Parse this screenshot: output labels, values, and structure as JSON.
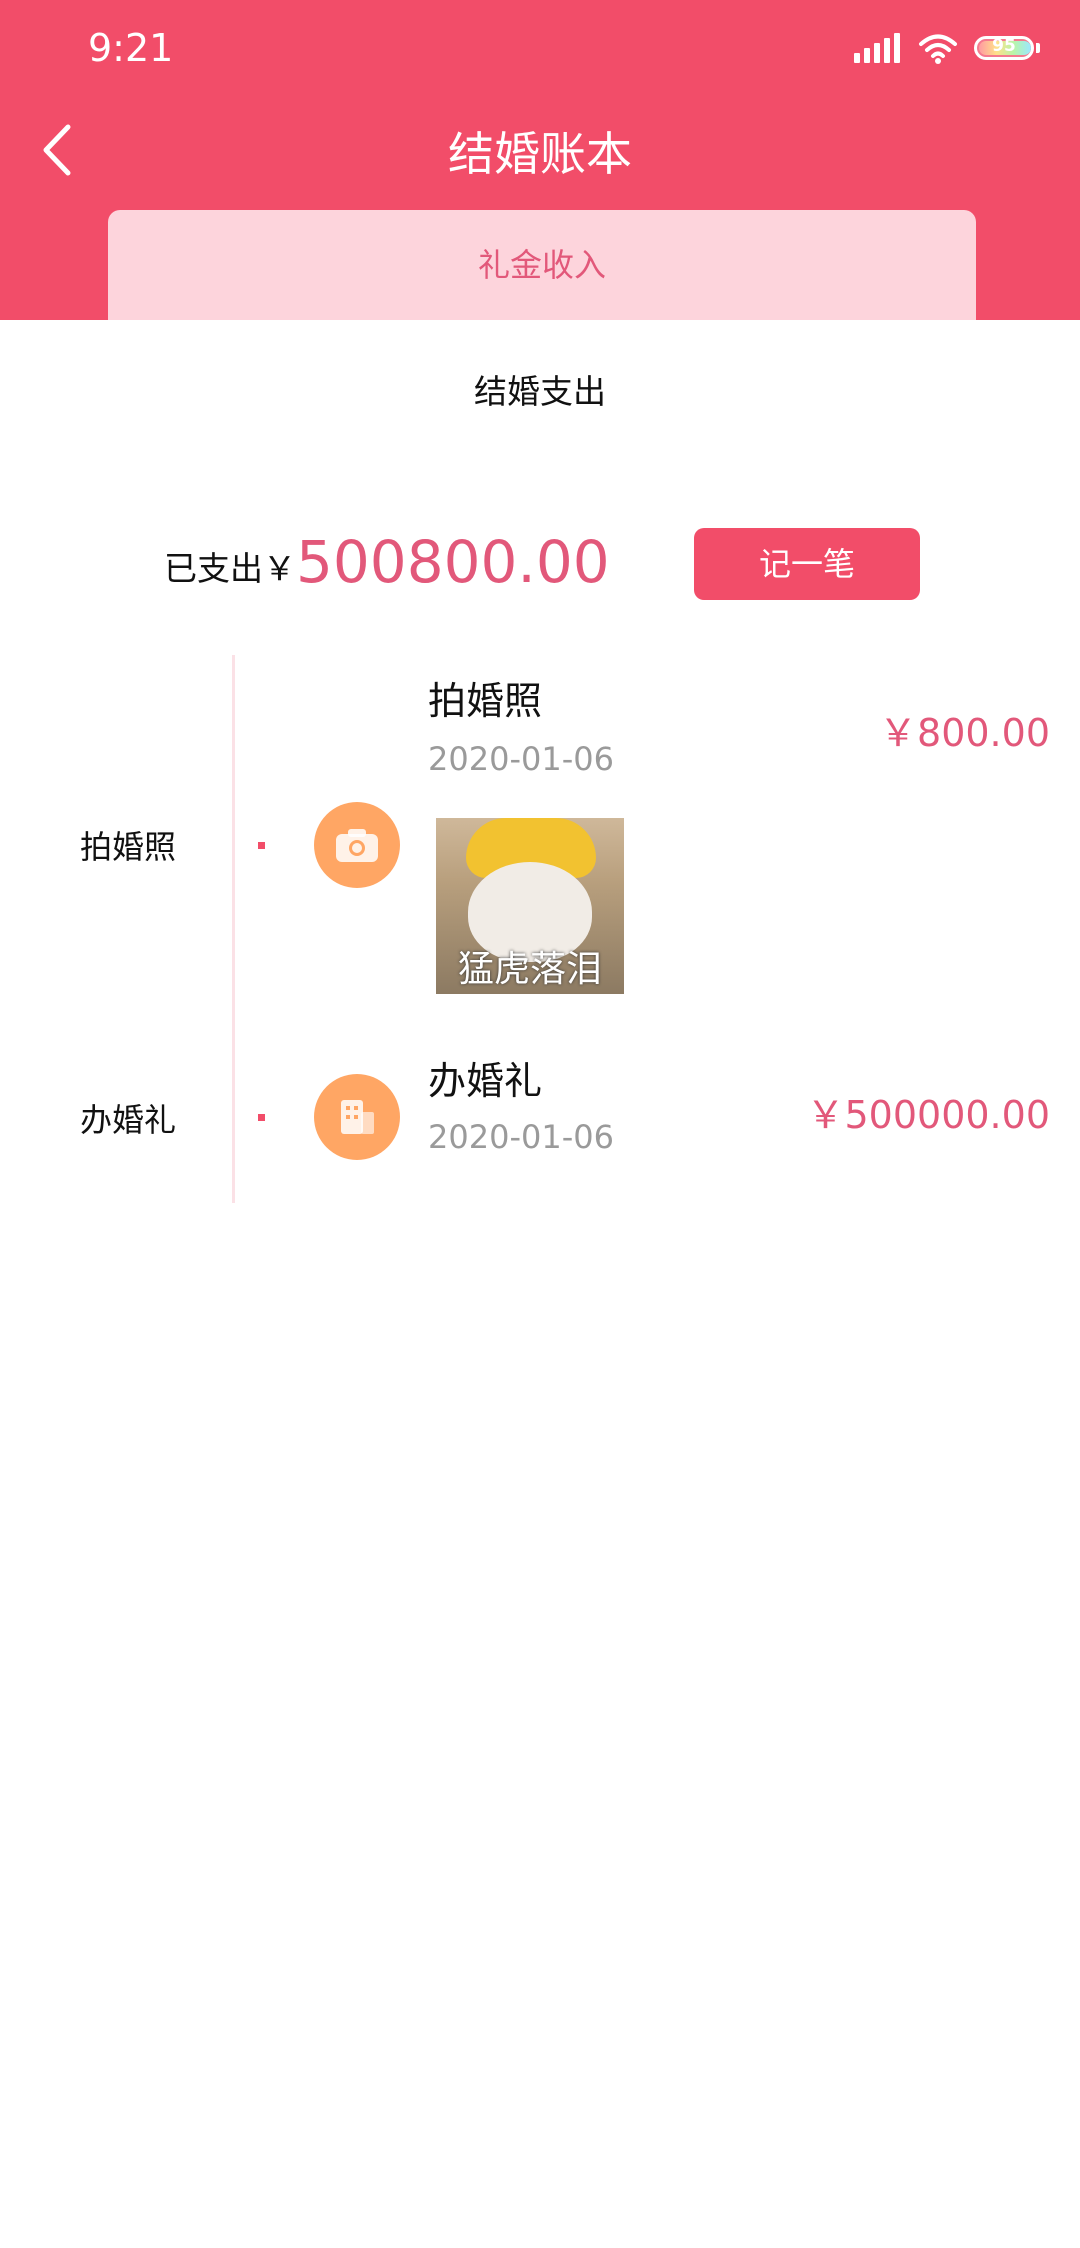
{
  "status_bar": {
    "time": "9:21",
    "battery": "95"
  },
  "header": {
    "title": "结婚账本"
  },
  "tabs": {
    "income": "礼金收入",
    "expense": "结婚支出"
  },
  "summary": {
    "label": "已支出￥",
    "amount": "500800.00",
    "button": "记一笔"
  },
  "entries": [
    {
      "category": "拍婚照",
      "title": "拍婚照",
      "date": "2020-01-06",
      "amount": "￥800.00",
      "icon": "camera-icon",
      "photo_caption": "猛虎落泪"
    },
    {
      "category": "办婚礼",
      "title": "办婚礼",
      "date": "2020-01-06",
      "amount": "￥500000.00",
      "icon": "building-icon"
    }
  ],
  "colors": {
    "brand": "#f24d69",
    "accent_text": "#e2587a",
    "tab_bg": "#fdd4dc",
    "icon_bg": "#ffa664"
  }
}
